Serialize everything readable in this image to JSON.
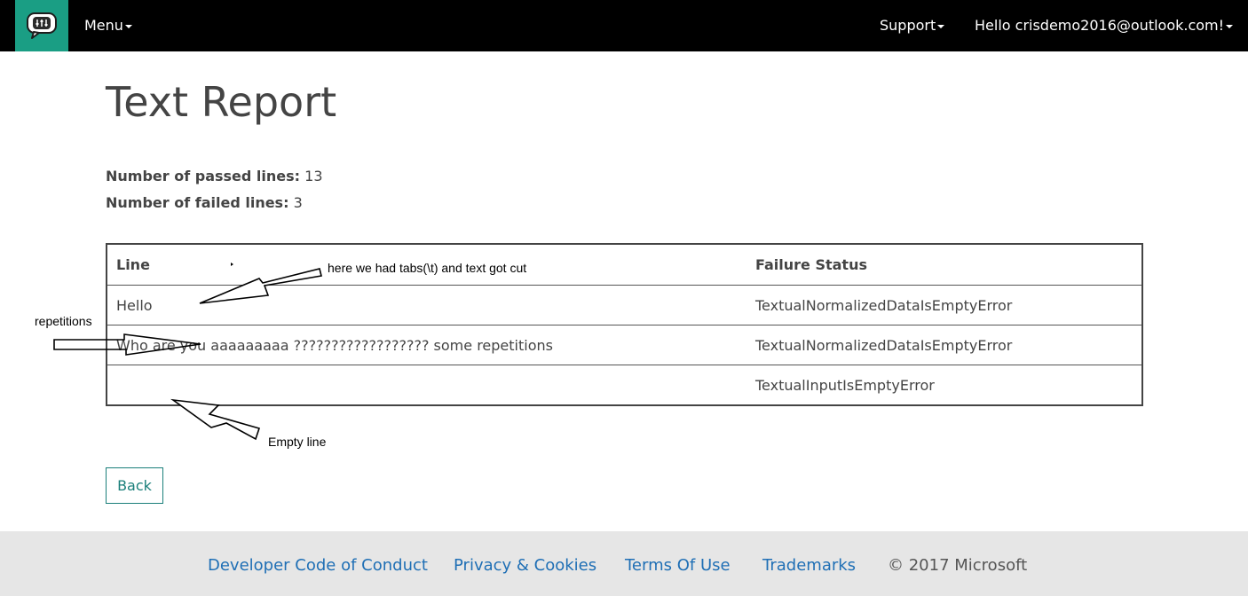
{
  "navbar": {
    "logo_icon": "chat-bubble-equalizer-icon",
    "menu_label": "Menu",
    "support_label": "Support",
    "user_label": "Hello crisdemo2016@outlook.com!"
  },
  "page": {
    "title": "Text Report",
    "passed_label": "Number of passed lines:",
    "passed_value": "13",
    "failed_label": "Number of failed lines:",
    "failed_value": "3"
  },
  "table": {
    "headers": [
      "Line",
      "Failure Status"
    ],
    "rows": [
      {
        "line": "Hello",
        "status": "TextualNormalizedDataIsEmptyError"
      },
      {
        "line": "Who are you aaaaaaaaa ?????????????????? some repetitions",
        "status": "TextualNormalizedDataIsEmptyError"
      },
      {
        "line": "",
        "status": "TextualInputIsEmptyError"
      }
    ]
  },
  "back_label": "Back",
  "footer": {
    "links": [
      "Developer Code of Conduct",
      "Privacy & Cookies",
      "Terms Of Use",
      "Trademarks"
    ],
    "copyright": "© 2017 Microsoft"
  },
  "annotations": {
    "tabs_note": "here we had tabs(\\t) and text got cut",
    "repetitions_note": "repetitions",
    "empty_note": "Empty line"
  },
  "colors": {
    "brand_teal": "#1a9e84",
    "navbar_bg": "#000000",
    "link_blue": "#1f6fb5",
    "button_teal": "#1a7f7a",
    "footer_bg": "#e6e6e6"
  }
}
